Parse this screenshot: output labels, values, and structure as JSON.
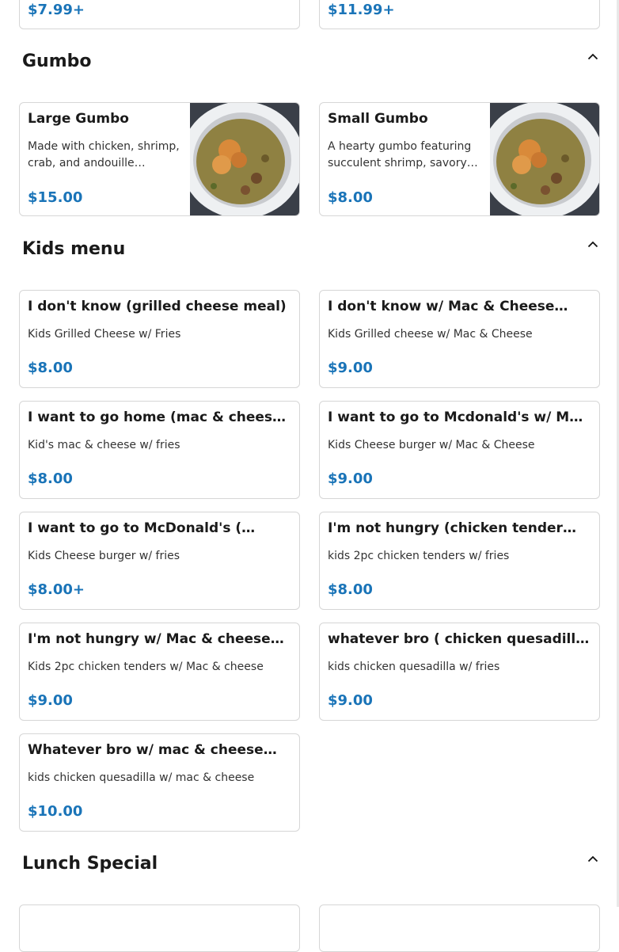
{
  "top_row": {
    "left_price": "$7.99+",
    "right_price": "$11.99+"
  },
  "sections": {
    "gumbo": {
      "title": "Gumbo",
      "items": [
        {
          "name": "Large Gumbo",
          "description": "Made with chicken, shrimp, crab, and andouille…",
          "price": "$15.00",
          "image": "gumbo-bowl-image"
        },
        {
          "name": "Small Gumbo",
          "description": "A hearty gumbo featuring succulent shrimp, savory…",
          "price": "$8.00",
          "image": "gumbo-bowl-image"
        }
      ]
    },
    "kids": {
      "title": "Kids menu",
      "items": [
        {
          "name": "I don't know (grilled cheese meal)",
          "description": "Kids Grilled Cheese w/ Fries",
          "price": "$8.00"
        },
        {
          "name": "I don't know w/ Mac & Cheese…",
          "description": "Kids Grilled cheese w/ Mac & Cheese",
          "price": "$9.00"
        },
        {
          "name": "I want to go home (mac & chees…",
          "description": "Kid's mac & cheese w/ fries",
          "price": "$8.00"
        },
        {
          "name": "I want to go to Mcdonald's w/ Ma…",
          "description": "Kids Cheese burger w/ Mac & Cheese",
          "price": "$9.00"
        },
        {
          "name": "I want to go to McDonald's (…",
          "description": "Kids Cheese burger w/ fries",
          "price": "$8.00+"
        },
        {
          "name": "I'm not hungry (chicken tender…",
          "description": "kids 2pc chicken tenders w/ fries",
          "price": "$8.00"
        },
        {
          "name": "I'm not hungry w/ Mac & cheese…",
          "description": "Kids 2pc chicken tenders w/ Mac & cheese",
          "price": "$9.00"
        },
        {
          "name": "whatever bro ( chicken quesadill…",
          "description": "kids chicken quesadilla w/ fries",
          "price": "$9.00"
        },
        {
          "name": "Whatever bro w/ mac & cheese…",
          "description": "kids chicken quesadilla w/ mac & cheese",
          "price": "$10.00"
        }
      ]
    },
    "lunch": {
      "title": "Lunch Special"
    }
  },
  "icons": {
    "collapse": "chevron-up-icon"
  },
  "colors": {
    "price": "#1a74b8",
    "border": "#d6d6d6"
  }
}
